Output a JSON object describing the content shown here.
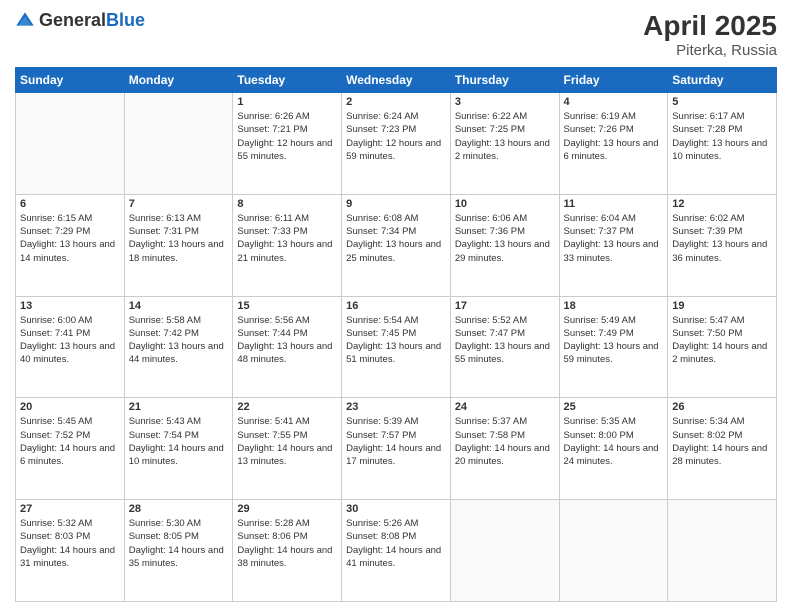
{
  "header": {
    "logo_general": "General",
    "logo_blue": "Blue",
    "title": "April 2025",
    "location": "Piterka, Russia"
  },
  "days_of_week": [
    "Sunday",
    "Monday",
    "Tuesday",
    "Wednesday",
    "Thursday",
    "Friday",
    "Saturday"
  ],
  "weeks": [
    [
      {
        "day": "",
        "info": ""
      },
      {
        "day": "",
        "info": ""
      },
      {
        "day": "1",
        "info": "Sunrise: 6:26 AM\nSunset: 7:21 PM\nDaylight: 12 hours and 55 minutes."
      },
      {
        "day": "2",
        "info": "Sunrise: 6:24 AM\nSunset: 7:23 PM\nDaylight: 12 hours and 59 minutes."
      },
      {
        "day": "3",
        "info": "Sunrise: 6:22 AM\nSunset: 7:25 PM\nDaylight: 13 hours and 2 minutes."
      },
      {
        "day": "4",
        "info": "Sunrise: 6:19 AM\nSunset: 7:26 PM\nDaylight: 13 hours and 6 minutes."
      },
      {
        "day": "5",
        "info": "Sunrise: 6:17 AM\nSunset: 7:28 PM\nDaylight: 13 hours and 10 minutes."
      }
    ],
    [
      {
        "day": "6",
        "info": "Sunrise: 6:15 AM\nSunset: 7:29 PM\nDaylight: 13 hours and 14 minutes."
      },
      {
        "day": "7",
        "info": "Sunrise: 6:13 AM\nSunset: 7:31 PM\nDaylight: 13 hours and 18 minutes."
      },
      {
        "day": "8",
        "info": "Sunrise: 6:11 AM\nSunset: 7:33 PM\nDaylight: 13 hours and 21 minutes."
      },
      {
        "day": "9",
        "info": "Sunrise: 6:08 AM\nSunset: 7:34 PM\nDaylight: 13 hours and 25 minutes."
      },
      {
        "day": "10",
        "info": "Sunrise: 6:06 AM\nSunset: 7:36 PM\nDaylight: 13 hours and 29 minutes."
      },
      {
        "day": "11",
        "info": "Sunrise: 6:04 AM\nSunset: 7:37 PM\nDaylight: 13 hours and 33 minutes."
      },
      {
        "day": "12",
        "info": "Sunrise: 6:02 AM\nSunset: 7:39 PM\nDaylight: 13 hours and 36 minutes."
      }
    ],
    [
      {
        "day": "13",
        "info": "Sunrise: 6:00 AM\nSunset: 7:41 PM\nDaylight: 13 hours and 40 minutes."
      },
      {
        "day": "14",
        "info": "Sunrise: 5:58 AM\nSunset: 7:42 PM\nDaylight: 13 hours and 44 minutes."
      },
      {
        "day": "15",
        "info": "Sunrise: 5:56 AM\nSunset: 7:44 PM\nDaylight: 13 hours and 48 minutes."
      },
      {
        "day": "16",
        "info": "Sunrise: 5:54 AM\nSunset: 7:45 PM\nDaylight: 13 hours and 51 minutes."
      },
      {
        "day": "17",
        "info": "Sunrise: 5:52 AM\nSunset: 7:47 PM\nDaylight: 13 hours and 55 minutes."
      },
      {
        "day": "18",
        "info": "Sunrise: 5:49 AM\nSunset: 7:49 PM\nDaylight: 13 hours and 59 minutes."
      },
      {
        "day": "19",
        "info": "Sunrise: 5:47 AM\nSunset: 7:50 PM\nDaylight: 14 hours and 2 minutes."
      }
    ],
    [
      {
        "day": "20",
        "info": "Sunrise: 5:45 AM\nSunset: 7:52 PM\nDaylight: 14 hours and 6 minutes."
      },
      {
        "day": "21",
        "info": "Sunrise: 5:43 AM\nSunset: 7:54 PM\nDaylight: 14 hours and 10 minutes."
      },
      {
        "day": "22",
        "info": "Sunrise: 5:41 AM\nSunset: 7:55 PM\nDaylight: 14 hours and 13 minutes."
      },
      {
        "day": "23",
        "info": "Sunrise: 5:39 AM\nSunset: 7:57 PM\nDaylight: 14 hours and 17 minutes."
      },
      {
        "day": "24",
        "info": "Sunrise: 5:37 AM\nSunset: 7:58 PM\nDaylight: 14 hours and 20 minutes."
      },
      {
        "day": "25",
        "info": "Sunrise: 5:35 AM\nSunset: 8:00 PM\nDaylight: 14 hours and 24 minutes."
      },
      {
        "day": "26",
        "info": "Sunrise: 5:34 AM\nSunset: 8:02 PM\nDaylight: 14 hours and 28 minutes."
      }
    ],
    [
      {
        "day": "27",
        "info": "Sunrise: 5:32 AM\nSunset: 8:03 PM\nDaylight: 14 hours and 31 minutes."
      },
      {
        "day": "28",
        "info": "Sunrise: 5:30 AM\nSunset: 8:05 PM\nDaylight: 14 hours and 35 minutes."
      },
      {
        "day": "29",
        "info": "Sunrise: 5:28 AM\nSunset: 8:06 PM\nDaylight: 14 hours and 38 minutes."
      },
      {
        "day": "30",
        "info": "Sunrise: 5:26 AM\nSunset: 8:08 PM\nDaylight: 14 hours and 41 minutes."
      },
      {
        "day": "",
        "info": ""
      },
      {
        "day": "",
        "info": ""
      },
      {
        "day": "",
        "info": ""
      }
    ]
  ]
}
